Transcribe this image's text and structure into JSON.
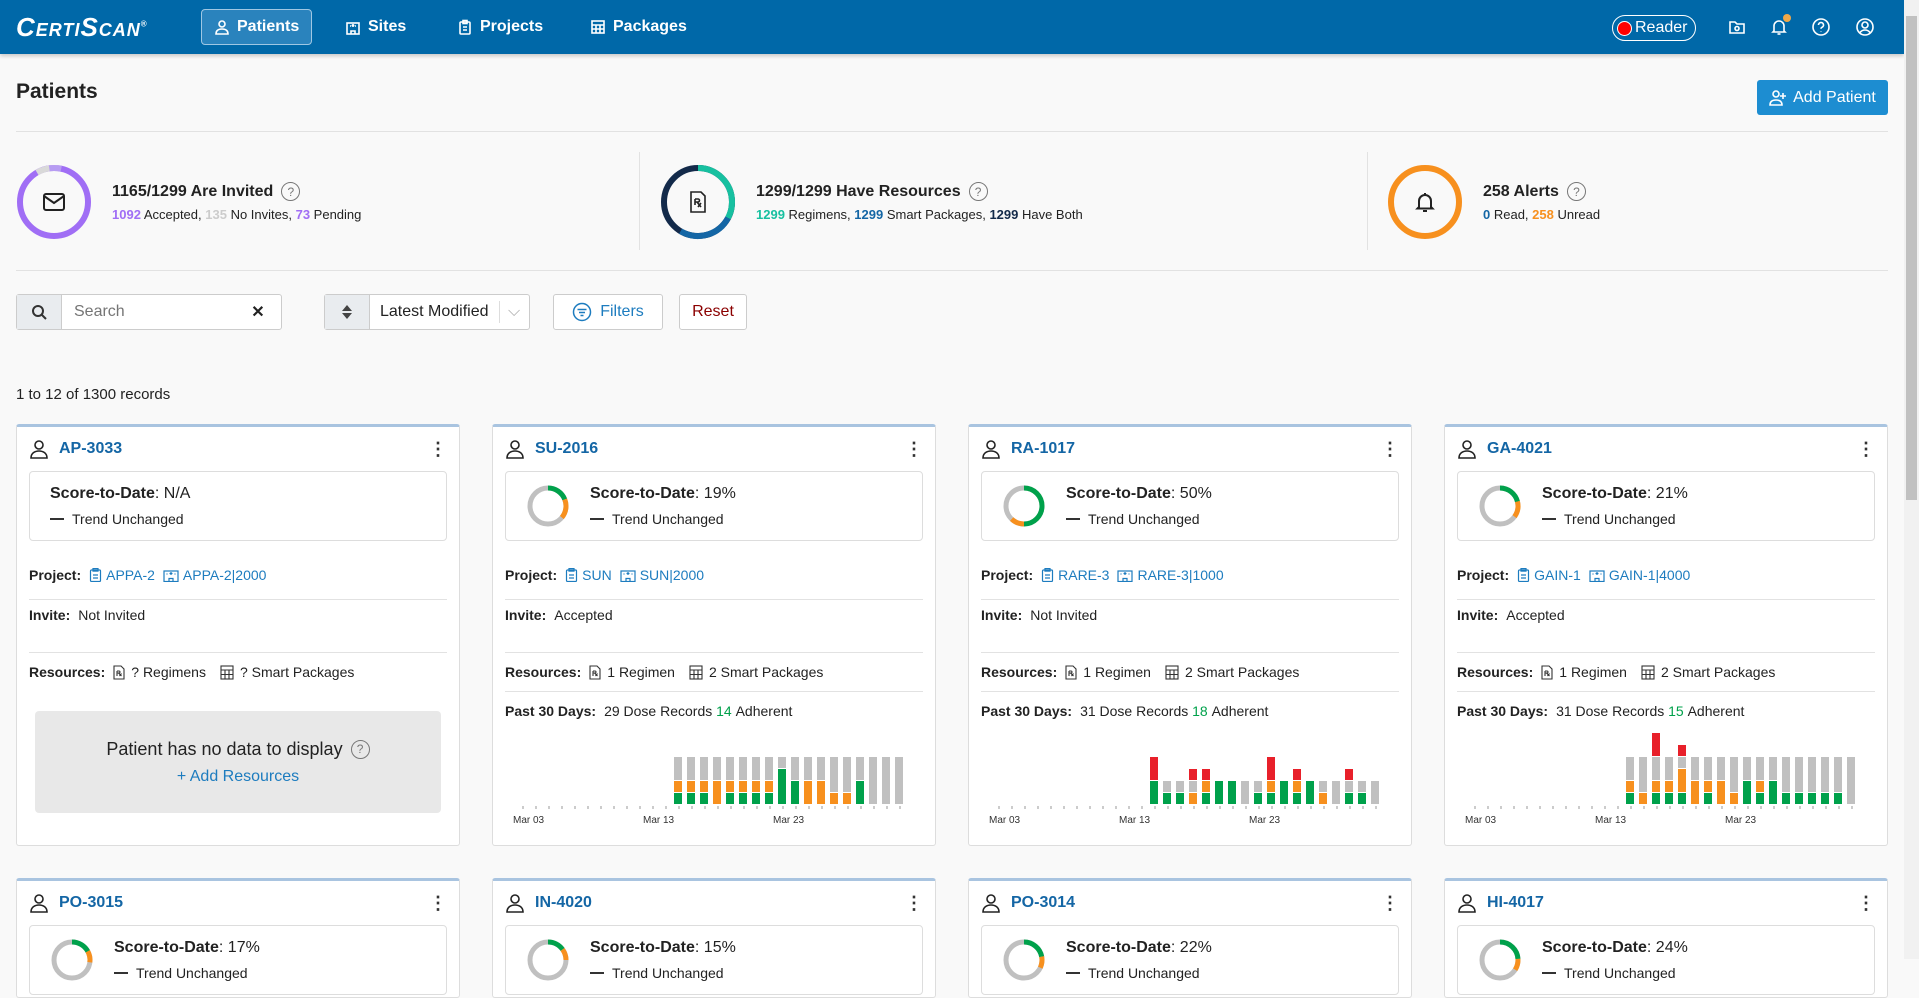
{
  "app": {
    "brand": "CertiScan"
  },
  "nav": [
    {
      "label": "Patients",
      "icon": "person-icon",
      "active": true
    },
    {
      "label": "Sites",
      "icon": "building-icon"
    },
    {
      "label": "Projects",
      "icon": "clipboard-icon"
    },
    {
      "label": "Packages",
      "icon": "package-icon"
    }
  ],
  "topbar": {
    "reader_label": "Reader",
    "icons": [
      "folder-settings-icon",
      "bell-icon",
      "help-icon",
      "user-circle-icon"
    ]
  },
  "page": {
    "title": "Patients",
    "add_button": "Add Patient"
  },
  "stats": {
    "invited": {
      "title": "1165/1299 Are Invited",
      "accepted": "1092",
      "accepted_label": " Accepted, ",
      "no_invites": "135",
      "no_invites_label": " No Invites, ",
      "pending": "73",
      "pending_label": " Pending",
      "colors": {
        "accepted": "#a06ef5",
        "no_invites": "#d9d9d9",
        "pending": "#b79cf2"
      }
    },
    "resources": {
      "title": "1299/1299 Have Resources",
      "regimens": "1299",
      "regimens_label": " Regimens, ",
      "smart": "1299",
      "smart_label": " Smart Packages, ",
      "both": "1299",
      "both_label": " Have Both",
      "colors": {
        "regimens": "#17c0a0",
        "smart": "#1466a5",
        "both": "#132a4a"
      }
    },
    "alerts": {
      "title": "258 Alerts",
      "read": "0",
      "read_label": " Read, ",
      "unread": "258",
      "unread_label": " Unread",
      "colors": {
        "read": "#1466a5",
        "unread": "#f7901e"
      }
    }
  },
  "toolbar": {
    "search_placeholder": "Search",
    "search_value": "",
    "sort_value": "Latest Modified",
    "filters_label": "Filters",
    "reset_label": "Reset"
  },
  "records_text": "1 to 12 of 1300 records",
  "labels": {
    "score": "Score-to-Date",
    "trend": "Trend Unchanged",
    "project": "Project:",
    "invite": "Invite:",
    "resources": "Resources:",
    "past30": "Past 30 Days:",
    "dose_records": "Dose Records",
    "adherent": "Adherent",
    "no_data": "Patient has no data to display",
    "add_resources": "+ Add Resources"
  },
  "chart_axis": {
    "ticks": [
      "Mar 03",
      "Mar 13",
      "Mar 23"
    ]
  },
  "patients": [
    {
      "id": "AP-3033",
      "score": "N/A",
      "score_pct": null,
      "project": "APPA-2",
      "site": "APPA-2|2000",
      "invite": "Not Invited",
      "regimens": "? Regimens",
      "packages": "? Smart Packages",
      "no_data": true
    },
    {
      "id": "SU-2016",
      "score": "19%",
      "score_pct": 19,
      "donut": {
        "green": 0.19,
        "orange": 0.17
      },
      "project": "SUN",
      "site": "SUN|2000",
      "invite": "Accepted",
      "regimens": "1 Regimen",
      "packages": "2 Smart Packages",
      "doses": "29",
      "adherent": "14",
      "chart": [
        [
          1,
          1,
          0,
          2
        ],
        [
          1,
          1,
          0,
          2
        ],
        [
          1,
          1,
          0,
          2
        ],
        [
          0,
          2,
          0,
          2
        ],
        [
          1,
          1,
          0,
          2
        ],
        [
          1,
          1,
          0,
          2
        ],
        [
          1,
          1,
          0,
          2
        ],
        [
          1,
          1,
          0,
          2
        ],
        [
          3,
          0,
          0,
          1
        ],
        [
          2,
          0,
          0,
          2
        ],
        [
          0,
          2,
          0,
          2
        ],
        [
          0,
          2,
          0,
          2
        ],
        [
          0,
          1,
          0,
          3
        ],
        [
          0,
          1,
          0,
          3
        ],
        [
          2,
          0,
          0,
          2
        ],
        [
          0,
          0,
          0,
          4
        ],
        [
          0,
          0,
          0,
          4
        ],
        [
          0,
          0,
          0,
          4
        ]
      ]
    },
    {
      "id": "RA-1017",
      "score": "50%",
      "score_pct": 50,
      "donut": {
        "green": 0.5,
        "orange": 0.12
      },
      "project": "RARE-3",
      "site": "RARE-3|1000",
      "invite": "Not Invited",
      "regimens": "1 Regimen",
      "packages": "2 Smart Packages",
      "doses": "31",
      "adherent": "18",
      "chart": [
        [
          2,
          0,
          2,
          0
        ],
        [
          1,
          0,
          0,
          1
        ],
        [
          1,
          0,
          0,
          1
        ],
        [
          0,
          1,
          1,
          1
        ],
        [
          1,
          1,
          1,
          0
        ],
        [
          2,
          0,
          0,
          0
        ],
        [
          2,
          0,
          0,
          0
        ],
        [
          0,
          0,
          0,
          2
        ],
        [
          1,
          0,
          0,
          1
        ],
        [
          1,
          1,
          2,
          0
        ],
        [
          2,
          0,
          0,
          0
        ],
        [
          1,
          1,
          1,
          0
        ],
        [
          2,
          0,
          0,
          0
        ],
        [
          0,
          1,
          0,
          1
        ],
        [
          0,
          0,
          0,
          2
        ],
        [
          1,
          0,
          1,
          1
        ],
        [
          1,
          0,
          0,
          1
        ],
        [
          0,
          0,
          0,
          2
        ]
      ]
    },
    {
      "id": "GA-4021",
      "score": "21%",
      "score_pct": 21,
      "donut": {
        "green": 0.21,
        "orange": 0.14
      },
      "project": "GAIN-1",
      "site": "GAIN-1|4000",
      "invite": "Accepted",
      "regimens": "1 Regimen",
      "packages": "2 Smart Packages",
      "doses": "31",
      "adherent": "15",
      "chart": [
        [
          1,
          1,
          0,
          2
        ],
        [
          0,
          1,
          0,
          3
        ],
        [
          1,
          1,
          2,
          2
        ],
        [
          1,
          1,
          0,
          2
        ],
        [
          1,
          2,
          1,
          1
        ],
        [
          0,
          2,
          0,
          2
        ],
        [
          1,
          1,
          0,
          2
        ],
        [
          0,
          2,
          0,
          2
        ],
        [
          0,
          1,
          0,
          3
        ],
        [
          2,
          0,
          0,
          2
        ],
        [
          1,
          1,
          0,
          2
        ],
        [
          2,
          0,
          0,
          2
        ],
        [
          1,
          0,
          0,
          3
        ],
        [
          1,
          0,
          0,
          3
        ],
        [
          1,
          0,
          0,
          3
        ],
        [
          1,
          0,
          0,
          3
        ],
        [
          1,
          0,
          0,
          3
        ],
        [
          0,
          0,
          0,
          4
        ]
      ]
    },
    {
      "id": "PO-3015",
      "score": "17%",
      "score_pct": 17
    },
    {
      "id": "IN-4020",
      "score": "15%",
      "score_pct": 15
    },
    {
      "id": "PO-3014",
      "score": "22%",
      "score_pct": 22
    },
    {
      "id": "HI-4017",
      "score": "24%",
      "score_pct": 24
    }
  ],
  "colors": {
    "brand": "#0068a8",
    "link": "#1466a5",
    "green": "#00a14b",
    "orange": "#f7901e",
    "red": "#e8202a",
    "gray": "#c0c0c0"
  }
}
